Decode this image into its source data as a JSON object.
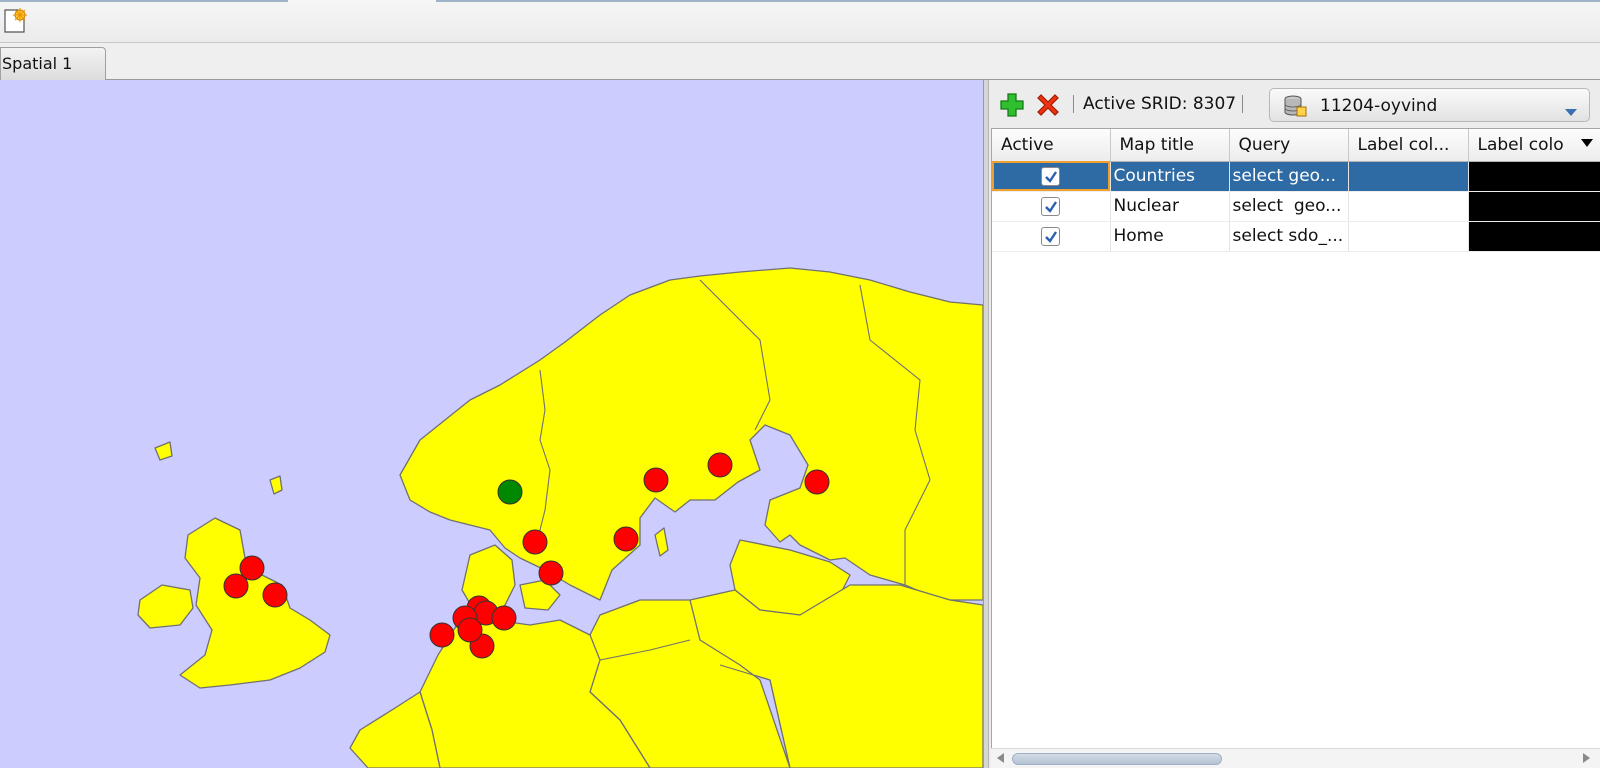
{
  "window": {
    "tab_label": "Spatial 1"
  },
  "toolbar": {
    "new_icon": "new-document-icon"
  },
  "layer_toolbar": {
    "add_icon": "add-plus-icon",
    "remove_icon": "remove-x-icon",
    "srid_label": "Active SRID: 8307",
    "connection": {
      "value": "11204-oyvind",
      "icon": "database-icon"
    }
  },
  "table": {
    "columns": [
      "Active",
      "Map title",
      "Query",
      "Label col...",
      "Label colo"
    ],
    "rows": [
      {
        "active": true,
        "title": "Countries",
        "query": "select geo...",
        "label_col": "",
        "selected": true
      },
      {
        "active": true,
        "title": "Nuclear",
        "query": "select  geo...",
        "label_col": "",
        "selected": false
      },
      {
        "active": true,
        "title": "Home",
        "query": "select sdo_...",
        "label_col": "",
        "selected": false
      }
    ]
  },
  "map": {
    "colors": {
      "sea": "#ccccff",
      "land": "#ffff00",
      "border": "#707070",
      "nuclear": "#ff0000",
      "home": "#008800"
    },
    "markers": {
      "nuclear_count": 16,
      "home_count": 1
    }
  }
}
